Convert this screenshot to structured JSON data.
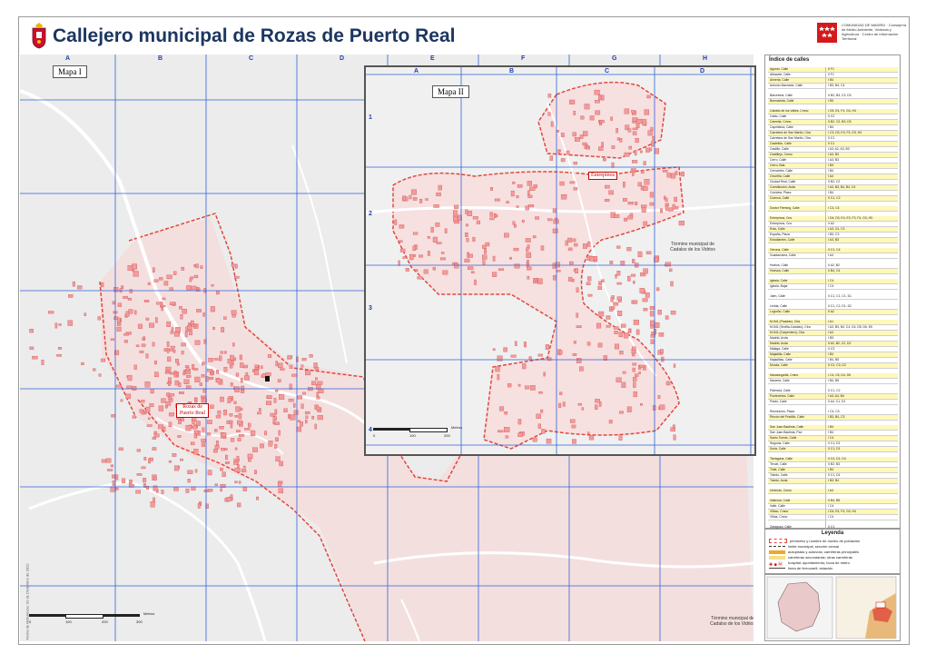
{
  "header": {
    "title": "Callejero municipal de Rozas de Puerto Real",
    "logo_text": "COMUNIDAD DE MADRID · Consejería de Medio Ambiente, Vivienda y Agricultura · Centro de Información Territorial"
  },
  "map1": {
    "tag": "Mapa I",
    "columns": [
      "A",
      "B",
      "C",
      "D",
      "E",
      "F",
      "G",
      "H"
    ],
    "rows": [
      "1",
      "2",
      "3",
      "4",
      "5",
      "6"
    ],
    "town_label": "Rozas de Puerto Real",
    "muni_label": "Término municipal de Cadalso de los Vidrios",
    "scale_title": "Metros",
    "scale_ticks": [
      "0",
      "100",
      "200",
      "300"
    ],
    "vertical_note": "Fecha de Referencia: 31 de Diciembre de 2022"
  },
  "map2": {
    "tag": "Mapa II",
    "columns": [
      "A",
      "B",
      "C",
      "D"
    ],
    "rows": [
      "1",
      "2",
      "3",
      "4"
    ],
    "place_label": "Entrepinos",
    "muni_label": "Término municipal de Cadalso de los Vidrios",
    "scale_title": "Metros",
    "scale_ticks": [
      "0",
      "100",
      "200"
    ]
  },
  "index": {
    "title": "Índice de calles",
    "rows": [
      {
        "name": "Agosto, Calle",
        "cells": "II F1"
      },
      {
        "name": "Albacete, Calle",
        "cells": "II F1"
      },
      {
        "name": "Almeria, Calle",
        "cells": "I B4"
      },
      {
        "name": "Antonio Machado, Calle",
        "cells": "I B3, B4, C4"
      },
      {
        "name": "",
        "cells": ""
      },
      {
        "name": "Barcelona, Calle",
        "cells": "II B2, B3, C3, D3"
      },
      {
        "name": "Buenavista, Calle",
        "cells": "I B3"
      },
      {
        "name": "",
        "cells": ""
      },
      {
        "name": "Caballo de los Valles, Cmno",
        "cells": "I D5, E4, F4, G4, H4"
      },
      {
        "name": "Cádiz, Calle",
        "cells": "II C2"
      },
      {
        "name": "Camelia, Cmno",
        "cells": "II B2, C2, B3, D3"
      },
      {
        "name": "Capellanía, Calle",
        "cells": "I B4"
      },
      {
        "name": "Carretera de San Martín, Ctra",
        "cells": "I C3, D3, E3, F3, G3, H3"
      },
      {
        "name": "Carretera de San Martín, Ctra",
        "cells": "II C1"
      },
      {
        "name": "Castellón, Calle",
        "cells": "II C1"
      },
      {
        "name": "Castillo, Calle",
        "cells": "I A3, A2, A3, B3"
      },
      {
        "name": "Castillejo, Cmno",
        "cells": "I A3, B3"
      },
      {
        "name": "Cerro, Calle",
        "cells": "I A3, B3"
      },
      {
        "name": "Cerro, Bda",
        "cells": "I B3"
      },
      {
        "name": "Cervantes, Calle",
        "cells": "I B4"
      },
      {
        "name": "Churrilla, Calle",
        "cells": "I A4"
      },
      {
        "name": "Ciudad Real, Calle",
        "cells": "II B2, C2"
      },
      {
        "name": "Constitución, Avda",
        "cells": "I A3, B3, B4, B4, C4"
      },
      {
        "name": "Córdoba, Plaza",
        "cells": "I B4"
      },
      {
        "name": "Cuenca, Calle",
        "cells": "II C1, C2"
      },
      {
        "name": "",
        "cells": ""
      },
      {
        "name": "Doctor Fleming, Calle",
        "cells": "I C3, C4"
      },
      {
        "name": "",
        "cells": ""
      },
      {
        "name": "Entrepinos, Cno",
        "cells": "I D4, D3, E4, E3, F3, F4, G3, H3"
      },
      {
        "name": "Entrepinos, Cno",
        "cells": "II A2"
      },
      {
        "name": "Eras, Calle",
        "cells": "I A3, C4, C3"
      },
      {
        "name": "España, Plaza",
        "cells": "I B3, C3"
      },
      {
        "name": "Estudiantes, Calle",
        "cells": "I A3, B3"
      },
      {
        "name": "",
        "cells": ""
      },
      {
        "name": "Gerona, Calle",
        "cells": "II C1, C4"
      },
      {
        "name": "Guadarrama, Calle",
        "cells": "I A4"
      },
      {
        "name": "",
        "cells": ""
      },
      {
        "name": "Huelva, Calle",
        "cells": "II A2, B2"
      },
      {
        "name": "Huesca, Calle",
        "cells": "II B4, C4"
      },
      {
        "name": "",
        "cells": ""
      },
      {
        "name": "Iglesia, Calle",
        "cells": "I C4"
      },
      {
        "name": "Iglesia, Bajar",
        "cells": "I C4"
      },
      {
        "name": "",
        "cells": ""
      },
      {
        "name": "Jaén, Calle",
        "cells": "II C1, C1, C1, D1"
      },
      {
        "name": "",
        "cells": ""
      },
      {
        "name": "Lérida, Calle",
        "cells": "II C1, C2, D1, D2"
      },
      {
        "name": "Logroño, Calle",
        "cells": "II A2"
      },
      {
        "name": "",
        "cells": ""
      },
      {
        "name": "M-541 (Picadas), Ctra",
        "cells": "I A1"
      },
      {
        "name": "M-541 (Sevilla-Cadalso), Ctra",
        "cells": "I A3, B3, B4, C4, D4, D5, D6, E6"
      },
      {
        "name": "M-541 (Carpentero), Ctra",
        "cells": "I A4"
      },
      {
        "name": "Madrid, Avda",
        "cells": "I B3"
      },
      {
        "name": "Madrid, Avda",
        "cells": "II A2, B2, C2, D2"
      },
      {
        "name": "Málaga, Calle",
        "cells": "II C3"
      },
      {
        "name": "Majadilla, Calle",
        "cells": "I B4"
      },
      {
        "name": "Majadillas, Calle",
        "cells": "I B4, B5"
      },
      {
        "name": "Murcia, Calle",
        "cells": "II C2, C3, D2"
      },
      {
        "name": "",
        "cells": ""
      },
      {
        "name": "Navalonguilla, Cmno",
        "cells": "I C4, C5, D4, D5"
      },
      {
        "name": "Navarra, Calle",
        "cells": "I B4, B5"
      },
      {
        "name": "",
        "cells": ""
      },
      {
        "name": "Palencia, Calle",
        "cells": "II C1, C2"
      },
      {
        "name": "Pontevedra, Calle",
        "cells": "I A3, A4, B4"
      },
      {
        "name": "Prado, Calle",
        "cells": "II A4, C1, D1"
      },
      {
        "name": "",
        "cells": ""
      },
      {
        "name": "Revolución, Plaza",
        "cells": "I C4, C3"
      },
      {
        "name": "Rincón del Pradillo, Calle",
        "cells": "I B3, B4, C3"
      },
      {
        "name": "",
        "cells": ""
      },
      {
        "name": "San Juan Bautista, Calle",
        "cells": "I B4"
      },
      {
        "name": "San Juan Bautista, Pza",
        "cells": "I B4"
      },
      {
        "name": "Santo Tomás, Calle",
        "cells": "I C4"
      },
      {
        "name": "Segovia, Calle",
        "cells": "II C1, D1"
      },
      {
        "name": "Soria, Calle",
        "cells": "II C1, D1"
      },
      {
        "name": "",
        "cells": ""
      },
      {
        "name": "Tarragona, Calle",
        "cells": "II C4, D1, D4"
      },
      {
        "name": "Teruel, Calle",
        "cells": "II B2, B3"
      },
      {
        "name": "Tinte, Calle",
        "cells": "I B4"
      },
      {
        "name": "Toledo, Calle",
        "cells": "II C1, D1"
      },
      {
        "name": "Toledo, Avda",
        "cells": "I B3, B4"
      },
      {
        "name": "",
        "cells": ""
      },
      {
        "name": "Umbrías, Cmno",
        "cells": "I A4"
      },
      {
        "name": "",
        "cells": ""
      },
      {
        "name": "Valencia, Calle",
        "cells": "II B4, B5"
      },
      {
        "name": "Valle, Calle",
        "cells": "I C4"
      },
      {
        "name": "Vilbao, Cmno",
        "cells": "I D4, E4, F4, G4, H4"
      },
      {
        "name": "Viñas, Cmno",
        "cells": "I C4"
      },
      {
        "name": "",
        "cells": ""
      },
      {
        "name": "Zaragoza, Calle",
        "cells": "II C1"
      }
    ]
  },
  "legend": {
    "title": "Leyenda",
    "items": [
      "perímetro y nombre de núcleo de población",
      "límite municipal, sección censal",
      "autopistas y autovías; carreteras principales",
      "carreteras secundarias; otras carreteras",
      "hospital; ayuntamiento; boca de metro",
      "línea de ferrocarril; estación"
    ],
    "colors": {
      "perimeter": "#e0483c",
      "roads_main": "#f5a623",
      "roads_sec": "#f3e08a",
      "rail": "#444444"
    }
  },
  "colors": {
    "grid": "#2f63d6",
    "buildings": "#f29a9a",
    "title": "#1c3660",
    "urban": "#fbd6d6",
    "map_bg": "#ececec"
  }
}
